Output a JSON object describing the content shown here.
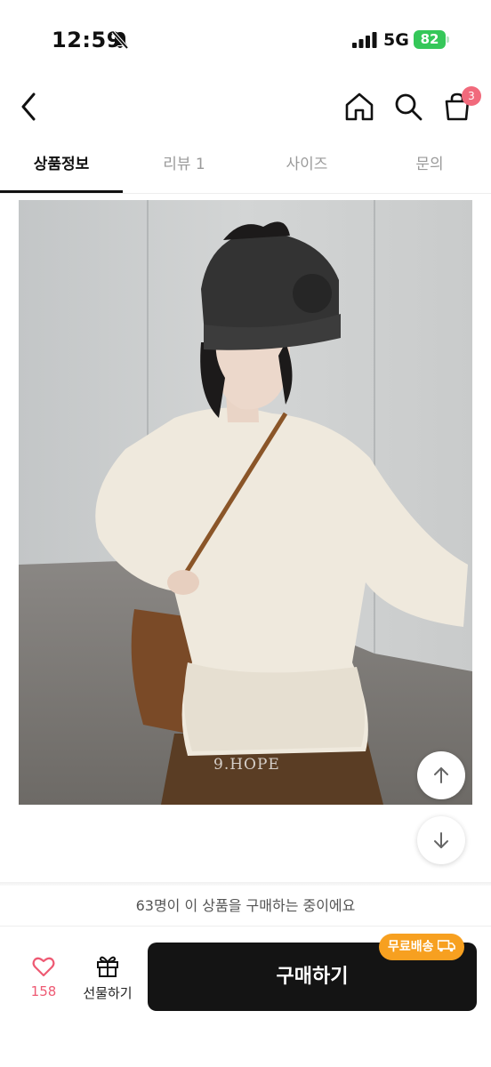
{
  "status_bar": {
    "time": "12:59",
    "network": "5G",
    "battery": "82"
  },
  "header": {
    "cart_count": "3"
  },
  "tabs": [
    "상품정보",
    "리뷰 1",
    "사이즈",
    "문의"
  ],
  "product_image": {
    "watermark": "9.HOPE"
  },
  "buying_notice": "63명이 이 상품을 구매하는 중이에요",
  "bottom_bar": {
    "like_count": "158",
    "gift_label": "선물하기",
    "buy_label": "구매하기",
    "free_shipping_badge": "무료배송"
  },
  "colors": {
    "accent_like": "#ee5a73",
    "badge": "#f7a020",
    "buy_button": "#141414"
  }
}
